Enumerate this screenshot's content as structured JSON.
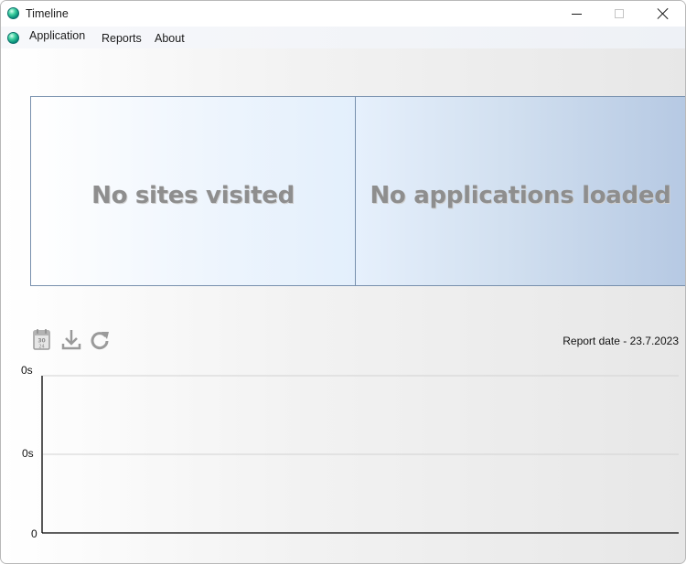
{
  "window": {
    "title": "Timeline"
  },
  "menu": {
    "items": [
      "Application",
      "Reports",
      "About"
    ]
  },
  "panels": {
    "sites_message": "No sites visited",
    "apps_message": "No applications loaded"
  },
  "toolbar": {
    "icons": [
      "calendar-icon",
      "download-icon",
      "refresh-icon"
    ]
  },
  "report": {
    "date_label": "Report date - 23.7.2023"
  },
  "chart_data": {
    "type": "bar",
    "categories": [],
    "series": [],
    "title": "",
    "xlabel": "",
    "ylabel": "",
    "y_tick_labels": [
      "0s",
      "0s",
      "0"
    ],
    "grid": true
  },
  "colors": {
    "panel_border": "#7890ad",
    "panel_text": "#8e8e8e",
    "accent_blue": "#b6c9e3"
  }
}
